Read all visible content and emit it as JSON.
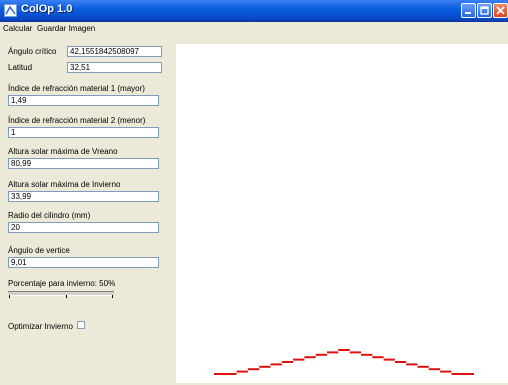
{
  "window": {
    "title": "ColOp 1.0"
  },
  "menu": {
    "items": [
      "Calcular",
      "Guardar Imagen"
    ]
  },
  "panel": {
    "critical_angle": {
      "label": "Ángulo crítico",
      "value": "42,1551842508097"
    },
    "latitude": {
      "label": "Latitud",
      "value": "32,51"
    },
    "refraction_1": {
      "label": "Índice de refracción material 1 (mayor)",
      "value": "1,49"
    },
    "refraction_2": {
      "label": "Índice de refracción material 2 (menor)",
      "value": "1"
    },
    "summer_height": {
      "label": "Altura solar máxima de Vreano",
      "value": "80,99"
    },
    "winter_height": {
      "label": "Altura solar máxima de Invierno",
      "value": "33,99"
    },
    "radius": {
      "label": "Radio del cilindro (mm)",
      "value": "20"
    },
    "vertex_angle": {
      "label": "Ángulo de vertice",
      "value": "9,01"
    },
    "winter_percent": {
      "label": "Porcentaje para invierno: 50%",
      "value": 0.5
    },
    "optimize": {
      "label": "Optimizar Invierno",
      "checked": false
    }
  },
  "chart_data": {
    "type": "line",
    "series": [
      {
        "color": "#e01010",
        "values": [
          0,
          0,
          1,
          2,
          3,
          4,
          5,
          6,
          7,
          8,
          9,
          10,
          9,
          8,
          7,
          6,
          5,
          4,
          3,
          2,
          1,
          0,
          0
        ]
      }
    ]
  }
}
